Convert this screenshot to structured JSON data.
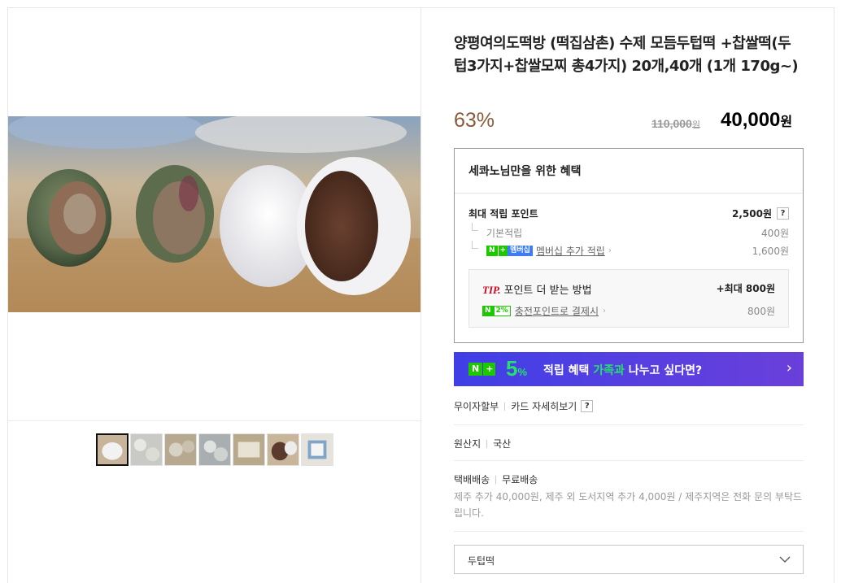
{
  "product": {
    "title": "양평여의도떡방 (떡집삼촌) 수제 모듬두텁떡 +찹쌀떡(두텁3가지+찹쌀모찌 총4가지) 20개,40개 (1개 170g~)",
    "discount_rate": "63%",
    "original_price": "110,000",
    "original_price_unit": "원",
    "sale_price": "40,000",
    "sale_price_unit": "원"
  },
  "benefit": {
    "title": "세콰노님만을 위한 혜택",
    "max_points_label": "최대 적립 포인트",
    "max_points_value": "2,500원",
    "help_icon_text": "?",
    "basic_label": "기본적립",
    "basic_value": "400원",
    "member_badge_n": "N",
    "member_badge_plus": "+",
    "member_badge_text": "멤버십",
    "member_label": "멤버십 추가 적립",
    "member_value": "1,600원",
    "tip": {
      "prefix": "TIP.",
      "label": "포인트 더 받는 방법",
      "max": "+최대 800원",
      "badge_n": "N",
      "badge_pct": "2%",
      "charge_label": "충전포인트로 결제시",
      "charge_value": "800원"
    }
  },
  "banner": {
    "badge_n": "N",
    "badge_plus": "+",
    "pct": "5",
    "pct_unit": "%",
    "text_a": "적립 혜택",
    "text_hl": "가족과",
    "text_b": "나누고 싶다면?",
    "arrow": "›"
  },
  "installment": {
    "label": "무이자할부",
    "card_link": "카드 자세히보기",
    "help": "?"
  },
  "origin": {
    "label": "원산지",
    "value": "국산"
  },
  "delivery": {
    "label": "택배배송",
    "value": "무료배송",
    "note": "제주 추가 40,000원, 제주 외 도서지역 추가 4,000원 / 제주지역은 전화 문의 부탁드립니다."
  },
  "option_select": {
    "value": "두텁떡"
  },
  "gallery": {
    "thumb_count": 7,
    "selected_index": 0
  },
  "colors": {
    "discount": "#8a5a3a",
    "banner_bg": "#4b3fe3",
    "banner_accent": "#25e06e",
    "npay_green": "#1ec800",
    "tip_red": "#d0021b"
  },
  "icons": {
    "option_chevron": "chevron-down-icon",
    "banner_arrow": "chevron-right-icon",
    "link_chevron": "chevron-right-icon"
  }
}
